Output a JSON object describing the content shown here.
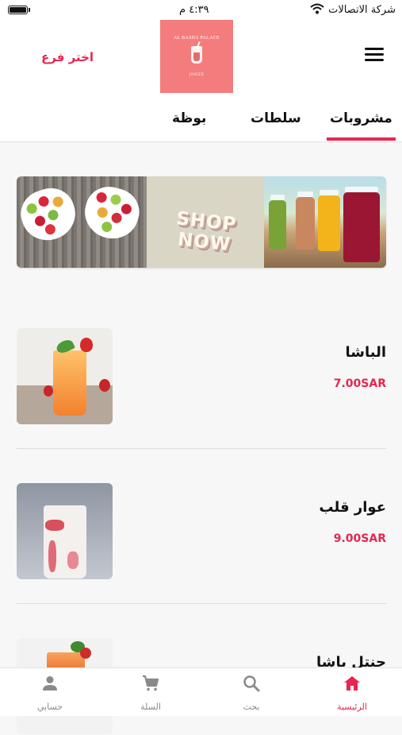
{
  "status_bar": {
    "carrier": "شركة الاتصالات",
    "time": "٤:٣٩ م"
  },
  "header": {
    "logo": {
      "name": "AL BASHA PALACE",
      "subtitle": "JUICES"
    },
    "branch_button": "اختر فرع",
    "menu_icon": "hamburger-icon"
  },
  "tabs": [
    {
      "label": "مشروبات",
      "active": true
    },
    {
      "label": "سلطات",
      "active": false
    },
    {
      "label": "بوظة",
      "active": false
    }
  ],
  "banner": {
    "text": "SHOP NOW"
  },
  "products": [
    {
      "name": "الباشا",
      "price": "7.00SAR"
    },
    {
      "name": "عوار قلب",
      "price": "9.00SAR"
    },
    {
      "name": "حنتل باشا",
      "price": ""
    }
  ],
  "bottom_nav": [
    {
      "label": "الرئيسية",
      "icon": "home-icon",
      "active": true
    },
    {
      "label": "بحث",
      "icon": "search-icon",
      "active": false
    },
    {
      "label": "السلة",
      "icon": "cart-icon",
      "active": false
    },
    {
      "label": "حسابي",
      "icon": "person-icon",
      "active": false
    }
  ],
  "colors": {
    "accent": "#e8254f",
    "logo_bg": "#f47c7c",
    "background": "#f7f7f7"
  }
}
